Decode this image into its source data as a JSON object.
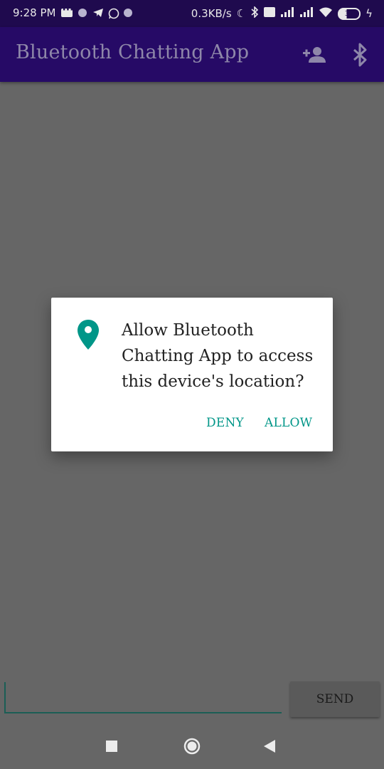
{
  "status_bar": {
    "time": "9:28 PM",
    "speed": "0.3KB/s",
    "battery": "37"
  },
  "app_bar": {
    "title": "Bluetooth Chatting App",
    "icons": [
      "add-user-icon",
      "bluetooth-icon"
    ]
  },
  "dialog": {
    "icon": "location-pin-icon",
    "message": "Allow Bluetooth Chatting App to access this device's location?",
    "deny_label": "DENY",
    "allow_label": "ALLOW",
    "accent_color": "#009688"
  },
  "composer": {
    "input_value": "",
    "send_label": "SEND"
  },
  "colors": {
    "status_bar": "#1f0a4e",
    "app_bar": "#260a66",
    "scrim": "#666666"
  }
}
